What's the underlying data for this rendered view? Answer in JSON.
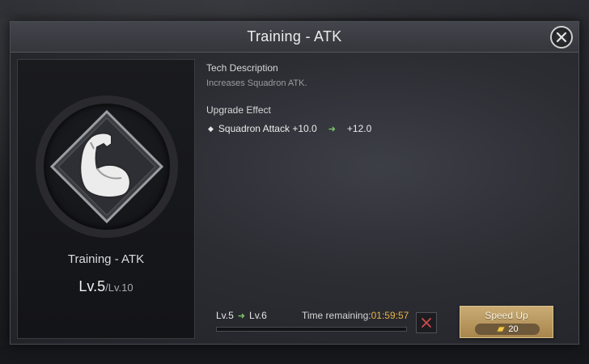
{
  "dialog": {
    "title": "Training - ATK"
  },
  "tech": {
    "name": "Training - ATK",
    "level_current": "Lv.5",
    "level_max": "/Lv.10",
    "icon": "flexed-arm-icon"
  },
  "description": {
    "heading": "Tech Description",
    "text": "Increases Squadron ATK."
  },
  "upgrade": {
    "heading": "Upgrade Effect",
    "stat": "Squadron Attack +10.0",
    "next_value": "+12.0"
  },
  "progress": {
    "from_level": "Lv.5",
    "to_level": "Lv.6",
    "time_label": "Time remaining:",
    "time_value": "01:59:57",
    "fraction": 0.0
  },
  "speed_up": {
    "label": "Speed Up",
    "cost": "20",
    "cost_icon": "gold-bar-icon"
  },
  "colors": {
    "accent_gold": "#c9ab74",
    "time_orange": "#e8b34a",
    "arrow_green": "#7ec86a",
    "cancel_red": "#d04a4a"
  }
}
